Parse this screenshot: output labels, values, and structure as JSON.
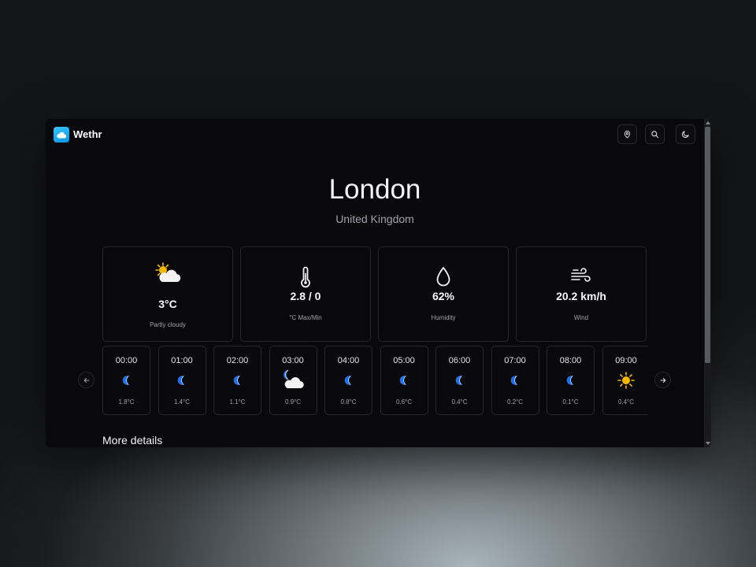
{
  "app": {
    "name": "Wethr"
  },
  "toolbar": {
    "icons": [
      "map-pin-icon",
      "search-icon",
      "moon-icon"
    ]
  },
  "location": {
    "city": "London",
    "country": "United Kingdom"
  },
  "cards": [
    {
      "icon": "partly-cloudy-icon",
      "value": "3°C",
      "label": "Partly cloudy"
    },
    {
      "icon": "thermometer-icon",
      "value": "2.8 / 0",
      "label": "°C Max/Min"
    },
    {
      "icon": "droplet-icon",
      "value": "62%",
      "label": "Humidity"
    },
    {
      "icon": "wind-icon",
      "value": "20.2 km/h",
      "label": "Wind"
    }
  ],
  "hourly": [
    {
      "time": "00:00",
      "icon": "moon-icon",
      "temp": "1.8°C"
    },
    {
      "time": "01:00",
      "icon": "moon-icon",
      "temp": "1.4°C"
    },
    {
      "time": "02:00",
      "icon": "moon-icon",
      "temp": "1.1°C"
    },
    {
      "time": "03:00",
      "icon": "cloudy-night-icon",
      "temp": "0.9°C"
    },
    {
      "time": "04:00",
      "icon": "moon-icon",
      "temp": "0.8°C"
    },
    {
      "time": "05:00",
      "icon": "moon-icon",
      "temp": "0.6°C"
    },
    {
      "time": "06:00",
      "icon": "moon-icon",
      "temp": "0.4°C"
    },
    {
      "time": "07:00",
      "icon": "moon-icon",
      "temp": "0.2°C"
    },
    {
      "time": "08:00",
      "icon": "moon-icon",
      "temp": "0.1°C"
    },
    {
      "time": "09:00",
      "icon": "sun-icon",
      "temp": "0.4°C"
    }
  ],
  "sections": {
    "more_details": "More details"
  },
  "colors": {
    "accent": "#0ea5e9",
    "moon": "#1d6ff2",
    "sun": "#f5b800",
    "background": "#09090b",
    "border": "#27272a"
  }
}
